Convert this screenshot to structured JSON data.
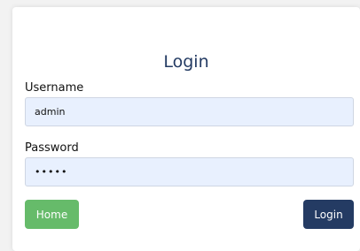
{
  "form": {
    "title": "Login",
    "username_label": "Username",
    "username_value": "admin",
    "password_label": "Password",
    "password_value": "admin"
  },
  "buttons": {
    "home_label": "Home",
    "login_label": "Login"
  },
  "colors": {
    "title": "#243b63",
    "input_bg": "#e8f0fe",
    "home_button": "#66bb6a",
    "login_button": "#243b63"
  }
}
